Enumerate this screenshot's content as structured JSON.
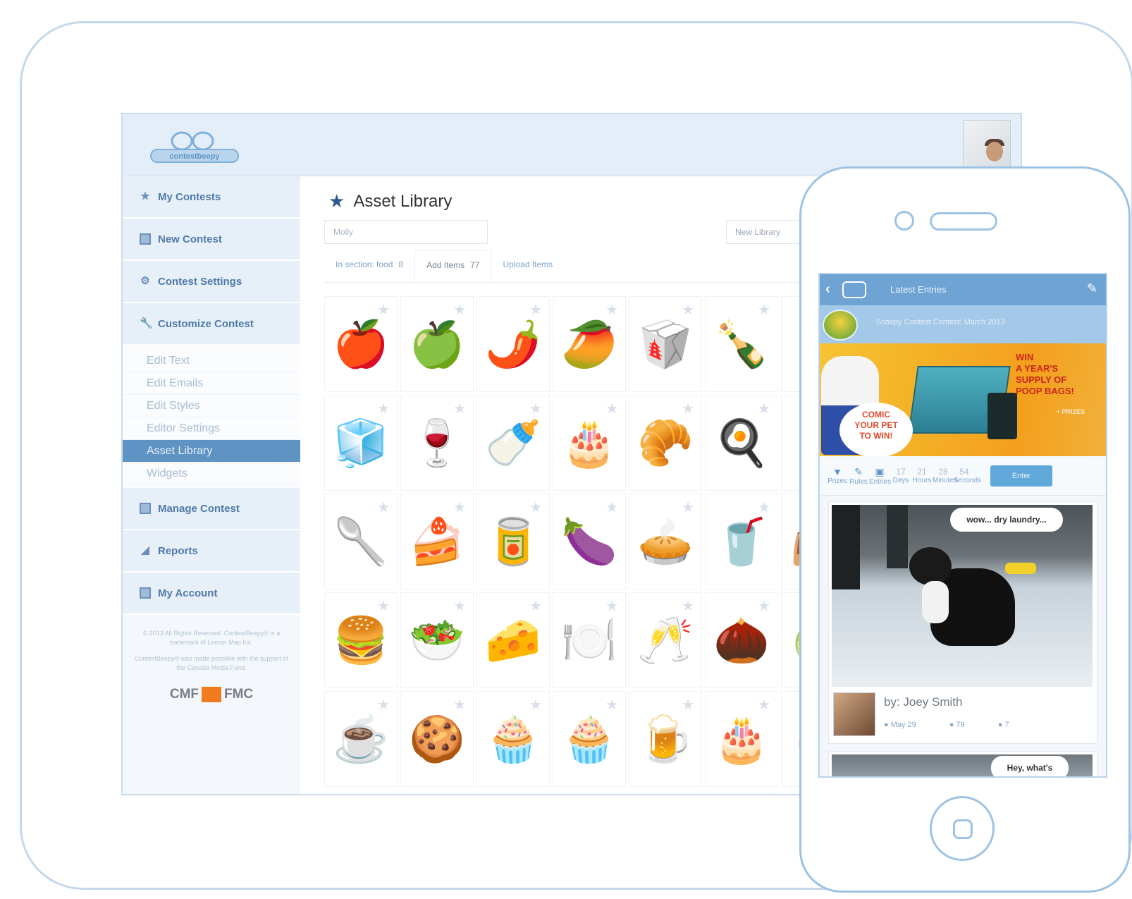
{
  "app": {
    "logo_text": "contestbeepy",
    "sidebar": {
      "primary_top": [
        {
          "label": "My Contests",
          "icon": "star-icon"
        },
        {
          "label": "New Contest",
          "icon": "new-icon"
        },
        {
          "label": "Contest Settings",
          "icon": "settings-icon"
        },
        {
          "label": "Customize Contest",
          "icon": "wrench-icon"
        }
      ],
      "sub_items": [
        "Edit Text",
        "Edit Emails",
        "Edit Styles",
        "Editor Settings",
        "Asset Library",
        "Widgets"
      ],
      "active_sub_index": 4,
      "primary_bottom": [
        {
          "label": "Manage Contest",
          "icon": "manage-icon"
        },
        {
          "label": "Reports",
          "icon": "chart-icon"
        },
        {
          "label": "My Account",
          "icon": "account-icon"
        }
      ],
      "footer_line1": "© 2013 All Rights Reserved. ContestBeepy® is a trademark of Lemon Map Inc.",
      "footer_line2": "ContestBeepy® was made possible with the support of the Canada Media Fund.",
      "fund_left": "CMF",
      "fund_right": "FMC"
    },
    "main": {
      "title": "Asset Library",
      "search_value": "Molly",
      "new_library_label": "New Library",
      "tabs": [
        {
          "label": "In section: food",
          "count": "8",
          "active": false
        },
        {
          "label": "Add Items",
          "count": "77",
          "active": true
        },
        {
          "label": "Upload Items",
          "count": "",
          "active": false
        }
      ],
      "assets": [
        {
          "icon": "🍎"
        },
        {
          "icon": "🍏"
        },
        {
          "icon": "🌶️"
        },
        {
          "icon": "🥭"
        },
        {
          "icon": "🥡"
        },
        {
          "icon": "🍾"
        },
        {
          "icon": "🍹"
        },
        {
          "icon": "🧊"
        },
        {
          "icon": "🍷"
        },
        {
          "icon": "🍼"
        },
        {
          "icon": "🎂"
        },
        {
          "icon": "🥐"
        },
        {
          "icon": "🍳"
        },
        {
          "icon": "🍵"
        },
        {
          "icon": "🥄"
        },
        {
          "icon": "🍰"
        },
        {
          "icon": "🥫"
        },
        {
          "icon": "🍆"
        },
        {
          "icon": "🥧"
        },
        {
          "icon": "🥤"
        },
        {
          "icon": "👜"
        },
        {
          "icon": "🍔"
        },
        {
          "icon": "🥗"
        },
        {
          "icon": "🧀"
        },
        {
          "icon": "🍽️"
        },
        {
          "icon": "🥂"
        },
        {
          "icon": "🌰"
        },
        {
          "icon": "🍈"
        },
        {
          "icon": "☕"
        },
        {
          "icon": "🍪"
        },
        {
          "icon": "🧁"
        },
        {
          "icon": "🧁"
        },
        {
          "icon": "🍺"
        },
        {
          "icon": "🎂"
        },
        {
          "icon": "🥚"
        }
      ]
    }
  },
  "phone": {
    "header_title": "Latest Entries",
    "banner_text": "Scoopy Contest Contest: March 2013",
    "promo_bubble_line1": "COMIC",
    "promo_bubble_line2": "YOUR PET",
    "promo_bubble_line3": "TO WIN!",
    "promo_win_line1": "WIN",
    "promo_win_line2": "A YEAR'S",
    "promo_win_line3": "SUPPLY OF",
    "promo_win_line4": "POOP BAGS!",
    "promo_sub": "+ PRIZES",
    "stats": [
      {
        "value": "",
        "label": "Prizes",
        "icon": "trophy-icon"
      },
      {
        "value": "",
        "label": "Rules",
        "icon": "pencil-icon"
      },
      {
        "value": "",
        "label": "Entries",
        "icon": "image-icon"
      },
      {
        "value": "17",
        "label": "Days"
      },
      {
        "value": "21",
        "label": "Hours"
      },
      {
        "value": "28",
        "label": "Minutes"
      },
      {
        "value": "54",
        "label": "Seconds"
      }
    ],
    "enter_label": "Enter",
    "post": {
      "caption": "wow... dry laundry...",
      "byline": "by: Joey Smith",
      "date": "May 29",
      "views": "79",
      "likes": "7"
    },
    "post2_caption": "Hey, what's"
  }
}
